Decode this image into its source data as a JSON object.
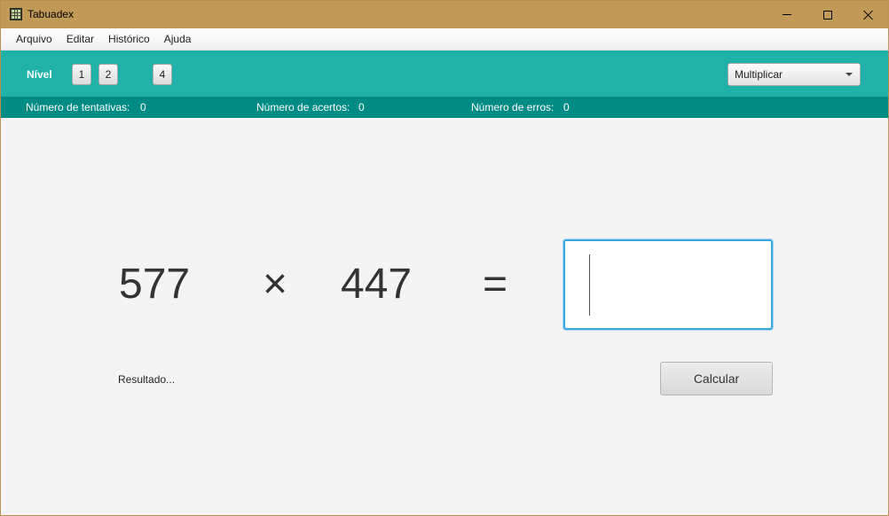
{
  "window": {
    "title": "Tabuadex"
  },
  "menu": {
    "items": [
      "Arquivo",
      "Editar",
      "Histórico",
      "Ajuda"
    ]
  },
  "toolbar": {
    "level_label": "Nível",
    "level_buttons": [
      "1",
      "2",
      "4"
    ],
    "operation": "Multiplicar"
  },
  "stats": {
    "attempts_label": "Número de tentativas:",
    "attempts_value": "0",
    "correct_label": "Número de acertos:",
    "correct_value": "0",
    "errors_label": "Número de erros:",
    "errors_value": "0"
  },
  "problem": {
    "operand_a": "577",
    "operator": "×",
    "operand_b": "447",
    "equals": "=",
    "answer_value": ""
  },
  "result": {
    "label": "Resultado..."
  },
  "actions": {
    "calculate_label": "Calcular"
  },
  "colors": {
    "titlebar": "#c29a58",
    "toolbar": "#20b2a9",
    "statsbar": "#008b84",
    "focus_border": "#3aa6e0"
  }
}
